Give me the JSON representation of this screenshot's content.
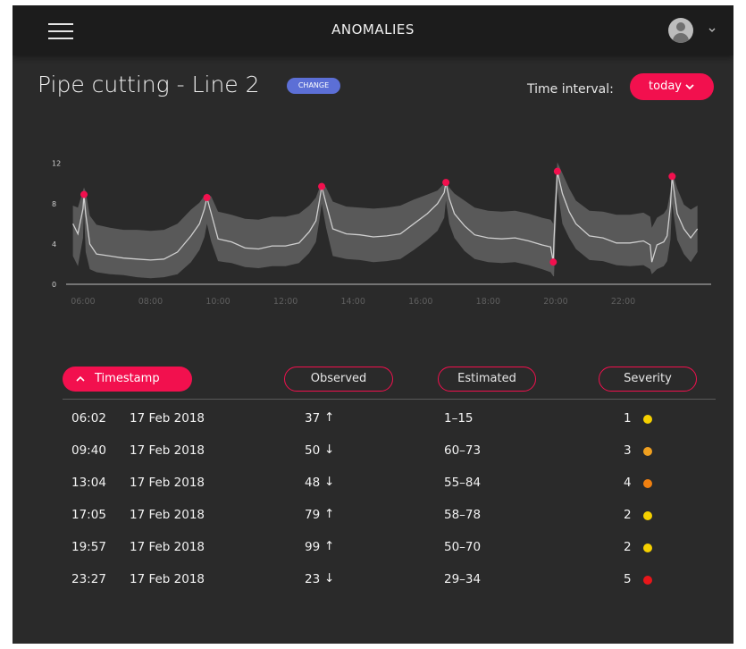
{
  "header": {
    "title": "ANOMALIES"
  },
  "page": {
    "title": "Pipe cutting - Line 2",
    "change_label": "CHANGE"
  },
  "interval": {
    "label": "Time interval:",
    "value": "today"
  },
  "colors": {
    "accent": "#f2104e",
    "change_button": "#5c6fd6",
    "band": "#5e5e5e",
    "line": "#cfcfcf",
    "severity": {
      "1": "#f5d000",
      "2": "#f5d000",
      "3": "#f0a020",
      "4": "#f08010",
      "5": "#e8161a"
    }
  },
  "icons": {
    "menu": "hamburger-icon",
    "avatar": "user-avatar-icon",
    "caret": "chevron-down-icon",
    "sort": "chevron-up-icon"
  },
  "chart_data": {
    "type": "line",
    "title": "",
    "xlabel": "",
    "ylabel": "",
    "x_ticks": [
      "06:00",
      "08:00",
      "10:00",
      "12:00",
      "14:00",
      "16:00",
      "18:00",
      "20:00",
      "22:00"
    ],
    "y_ticks": [
      "0",
      "4",
      "8",
      "12"
    ],
    "xlim": [
      5.5,
      24.5
    ],
    "ylim": [
      0,
      12.5
    ],
    "grid": false,
    "series": [
      {
        "x": [
          5.7,
          5.85,
          6.0,
          6.03,
          6.08,
          6.2,
          6.4,
          6.8,
          7.2,
          7.6,
          8.0,
          8.4,
          8.8,
          9.2,
          9.45,
          9.6,
          9.67,
          9.8,
          10.0,
          10.4,
          10.8,
          11.2,
          11.6,
          12.0,
          12.4,
          12.7,
          12.9,
          13.0,
          13.07,
          13.2,
          13.4,
          13.8,
          14.2,
          14.6,
          15.0,
          15.4,
          15.8,
          16.2,
          16.5,
          16.7,
          16.75,
          16.85,
          17.0,
          17.3,
          17.6,
          18.0,
          18.4,
          18.8,
          19.2,
          19.6,
          19.85,
          19.93,
          19.95,
          20.05,
          20.2,
          20.4,
          20.6,
          21.0,
          21.4,
          21.8,
          22.2,
          22.6,
          22.8,
          22.85,
          23.0,
          23.2,
          23.3,
          23.4,
          23.45,
          23.6,
          23.8,
          24.0,
          24.2
        ],
        "y": [
          6.0,
          5.0,
          7.5,
          8.9,
          7.0,
          4.0,
          3.0,
          2.8,
          2.6,
          2.5,
          2.4,
          2.5,
          3.2,
          4.8,
          6.0,
          7.5,
          8.6,
          7.0,
          4.5,
          4.2,
          3.6,
          3.5,
          3.8,
          3.8,
          4.1,
          5.2,
          6.3,
          8.2,
          9.7,
          8.0,
          5.5,
          5.0,
          4.9,
          4.7,
          4.8,
          5.0,
          6.0,
          7.0,
          8.0,
          9.1,
          10.1,
          8.5,
          7.0,
          5.8,
          4.9,
          4.6,
          4.5,
          4.6,
          4.3,
          3.9,
          3.7,
          2.2,
          4.5,
          11.2,
          9.0,
          7.2,
          6.0,
          4.8,
          4.6,
          4.1,
          4.1,
          4.3,
          3.9,
          2.2,
          3.9,
          4.2,
          4.8,
          7.8,
          10.7,
          7.0,
          5.5,
          4.6,
          5.5
        ]
      }
    ],
    "band": {
      "lower": [
        2.8,
        1.8,
        4.6,
        7.5,
        3.2,
        1.5,
        1.2,
        1.0,
        0.9,
        0.7,
        0.6,
        0.7,
        1.0,
        2.2,
        3.4,
        4.7,
        6.0,
        4.2,
        2.3,
        2.1,
        1.7,
        1.6,
        1.8,
        1.8,
        2.1,
        3.1,
        4.2,
        6.3,
        8.0,
        5.6,
        2.8,
        2.5,
        2.4,
        2.2,
        2.3,
        2.5,
        3.4,
        4.4,
        5.3,
        6.6,
        8.3,
        6.0,
        4.6,
        3.3,
        2.5,
        2.2,
        2.1,
        2.2,
        1.9,
        1.5,
        1.2,
        0.8,
        0.8,
        9.5,
        6.0,
        4.6,
        3.5,
        2.4,
        2.3,
        1.9,
        1.8,
        1.9,
        1.5,
        1.0,
        1.5,
        1.8,
        2.3,
        4.4,
        8.0,
        4.4,
        3.0,
        2.2,
        3.2
      ],
      "upper": [
        7.8,
        7.6,
        9.3,
        9.6,
        9.2,
        6.8,
        5.9,
        5.6,
        5.4,
        5.4,
        5.3,
        5.4,
        6.0,
        7.4,
        8.1,
        8.8,
        9.0,
        8.7,
        7.2,
        6.9,
        6.5,
        6.4,
        6.7,
        6.7,
        7.0,
        7.8,
        8.6,
        9.5,
        10.1,
        9.6,
        8.2,
        7.7,
        7.6,
        7.5,
        7.6,
        7.8,
        8.4,
        8.9,
        9.3,
        10.0,
        10.3,
        9.6,
        9.0,
        8.3,
        7.6,
        7.3,
        7.2,
        7.3,
        7.0,
        6.6,
        6.4,
        6.0,
        7.4,
        12.1,
        11.0,
        9.5,
        8.3,
        7.3,
        7.2,
        6.9,
        6.9,
        7.1,
        6.7,
        5.6,
        6.6,
        7.0,
        7.5,
        9.2,
        11.2,
        9.5,
        7.9,
        7.4,
        7.8
      ]
    },
    "anomalies": [
      {
        "x": 6.03,
        "y": 8.9
      },
      {
        "x": 9.67,
        "y": 8.6
      },
      {
        "x": 13.07,
        "y": 9.7
      },
      {
        "x": 16.75,
        "y": 10.1
      },
      {
        "x": 19.93,
        "y": 2.2
      },
      {
        "x": 20.05,
        "y": 11.2
      },
      {
        "x": 23.45,
        "y": 10.7
      }
    ]
  },
  "table": {
    "headers": {
      "timestamp": "Timestamp",
      "observed": "Observed",
      "estimated": "Estimated",
      "severity": "Severity"
    },
    "rows": [
      {
        "time": "06:02",
        "date": "17 Feb 2018",
        "observed": "37",
        "direction": "↑",
        "estimated": "1–15",
        "severity": "1",
        "severity_color": "#f5d000"
      },
      {
        "time": "09:40",
        "date": "17 Feb 2018",
        "observed": "50",
        "direction": "↓",
        "estimated": "60–73",
        "severity": "3",
        "severity_color": "#f0a020"
      },
      {
        "time": "13:04",
        "date": "17 Feb 2018",
        "observed": "48",
        "direction": "↓",
        "estimated": "55–84",
        "severity": "4",
        "severity_color": "#f08010"
      },
      {
        "time": "17:05",
        "date": "17 Feb 2018",
        "observed": "79",
        "direction": "↑",
        "estimated": "58–78",
        "severity": "2",
        "severity_color": "#f5d000"
      },
      {
        "time": "19:57",
        "date": "17 Feb 2018",
        "observed": "99",
        "direction": "↑",
        "estimated": "50–70",
        "severity": "2",
        "severity_color": "#f5d000"
      },
      {
        "time": "23:27",
        "date": "17 Feb 2018",
        "observed": "23",
        "direction": "↓",
        "estimated": "29–34",
        "severity": "5",
        "severity_color": "#e8161a"
      }
    ]
  }
}
